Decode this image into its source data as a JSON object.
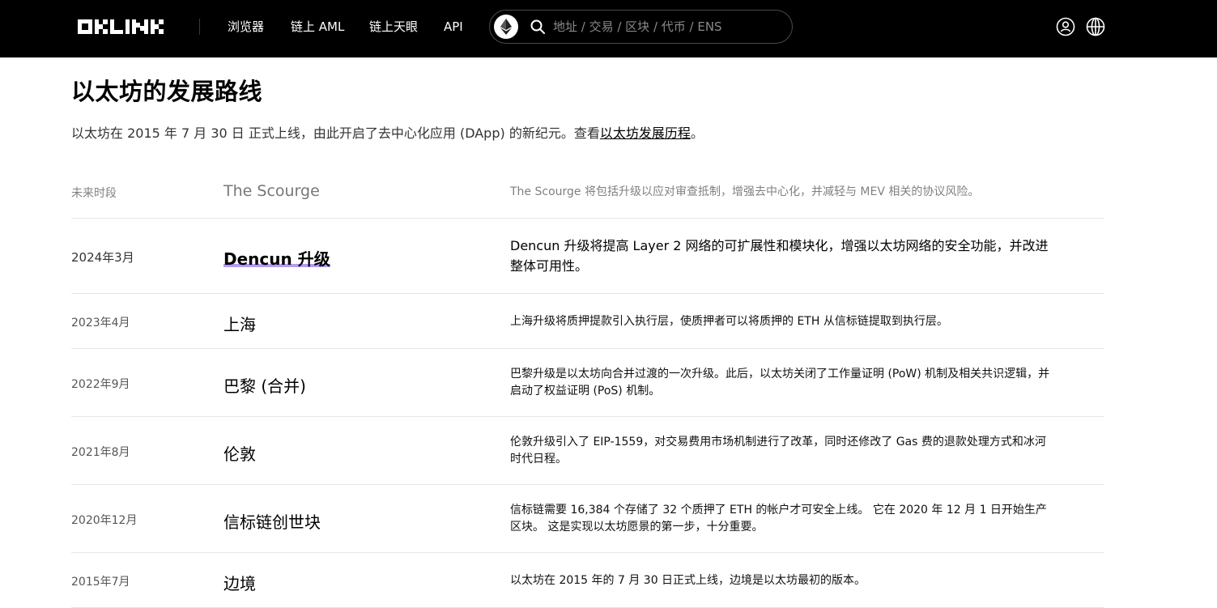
{
  "header": {
    "logo_text": "OKLINK",
    "nav": [
      {
        "label": "浏览器"
      },
      {
        "label": "链上 AML"
      },
      {
        "label": "链上天眼"
      },
      {
        "label": "API"
      }
    ],
    "search": {
      "chain_icon": "ethereum-icon",
      "placeholder": "地址 / 交易 / 区块 / 代币 / ENS"
    },
    "icons": [
      "user-icon",
      "globe-icon"
    ]
  },
  "main": {
    "title": "以太坊的发展路线",
    "intro_text": "以太坊在 2015 年 7 月 30 日 正式上线，由此开启了去中心化应用 (DApp) 的新纪元。查看",
    "intro_link": "以太坊发展历程",
    "intro_suffix": "。",
    "timeline": [
      {
        "date": "未来时段",
        "name": "The Scourge",
        "desc": "The Scourge 将包括升级以应对审查抵制，增强去中心化，并减轻与 MEV 相关的协议风险。"
      },
      {
        "date": "2024年3月",
        "name": "Dencun 升级",
        "desc": "Dencun 升级将提高 Layer 2 网络的可扩展性和模块化，增强以太坊网络的安全功能，并改进整体可用性。"
      },
      {
        "date": "2023年4月",
        "name": "上海",
        "desc": "上海升级将质押提款引入执行层，使质押者可以将质押的 ETH 从信标链提取到执行层。"
      },
      {
        "date": "2022年9月",
        "name": "巴黎 (合并)",
        "desc": "巴黎升级是以太坊向合并过渡的一次升级。此后，以太坊关闭了工作量证明 (PoW) 机制及相关共识逻辑，并启动了权益证明 (PoS) 机制。"
      },
      {
        "date": "2021年8月",
        "name": "伦敦",
        "desc": "伦敦升级引入了 EIP-1559，对交易费用市场机制进行了改革，同时还修改了 Gas 费的退款处理方式和冰河时代日程。"
      },
      {
        "date": "2020年12月",
        "name": "信标链创世块",
        "desc": "信标链需要 16,384 个存储了 32 个质押了 ETH 的帐户才可安全上线。 它在 2020 年 12 月 1 日开始生产区块。 这是实现以太坊愿景的第一步，十分重要。"
      },
      {
        "date": "2015年7月",
        "name": "边境",
        "desc": "以太坊在 2015 年的 7 月 30 日正式上线，边境是以太坊最初的版本。"
      }
    ]
  }
}
